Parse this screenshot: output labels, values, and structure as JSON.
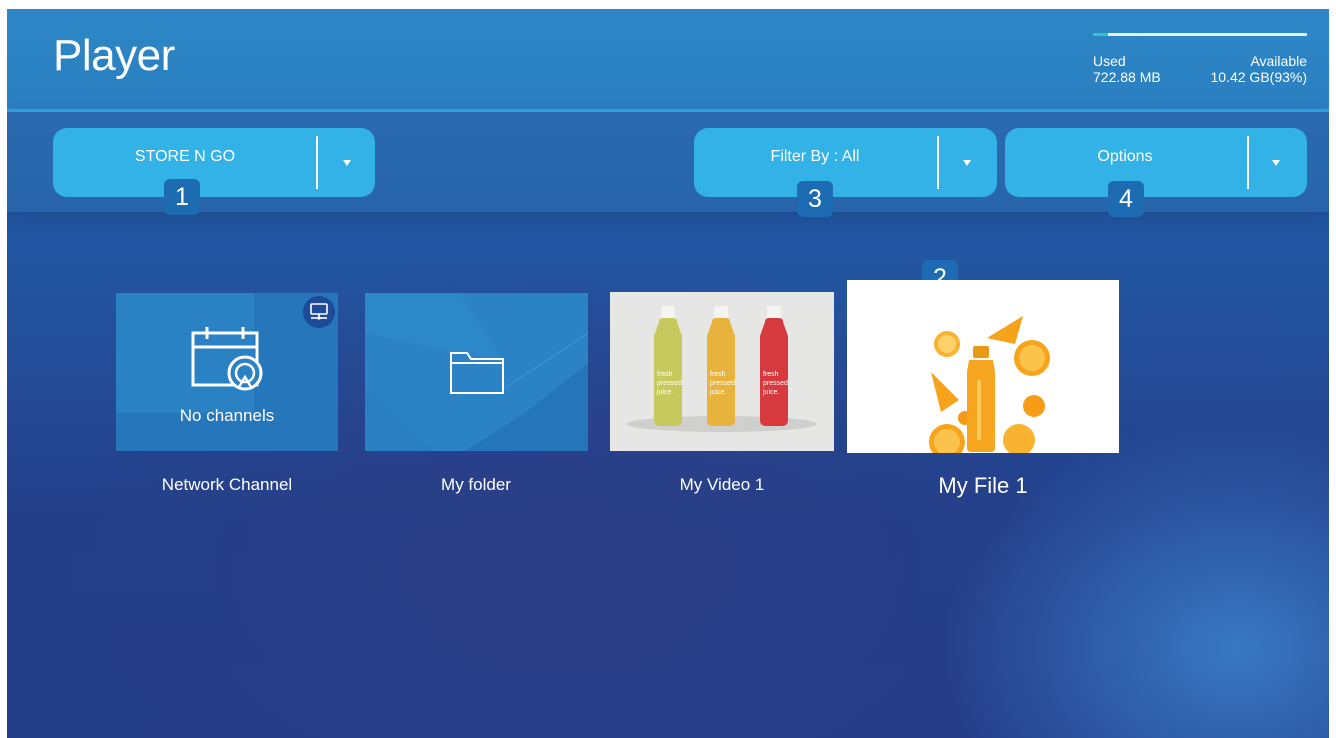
{
  "header": {
    "title": "Player",
    "storage": {
      "used_label": "Used",
      "used_value": "722.88 MB",
      "available_label": "Available",
      "available_value": "10.42 GB(93%)",
      "used_fraction": 0.07
    }
  },
  "toolbar": {
    "storage_select": "STORE N GO",
    "filter": "Filter By : All",
    "options": "Options"
  },
  "badges": [
    "1",
    "2",
    "3",
    "4"
  ],
  "tiles": [
    {
      "label": "Network Channel",
      "overlay_text": "No channels",
      "icon": "calendar-sync-icon"
    },
    {
      "label": "My folder",
      "icon": "folder-icon"
    },
    {
      "label": "My Video 1",
      "bottle_text": "fresh pressed juice."
    },
    {
      "label": "My File 1"
    }
  ],
  "colors": {
    "header": "#2d87c7",
    "dropdown": "#32b2e6",
    "badge": "#1d6bb2",
    "storage_fill": "#2fc8c0"
  }
}
